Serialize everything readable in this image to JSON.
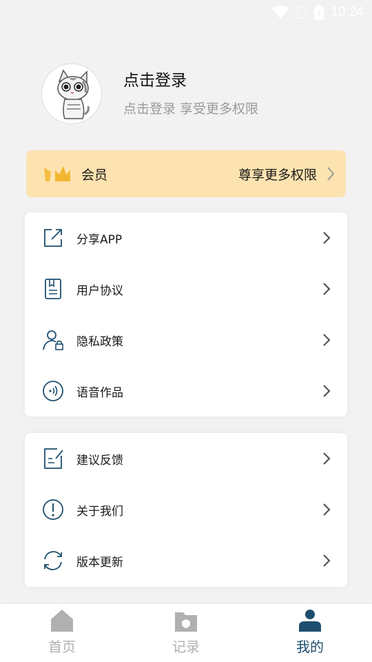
{
  "status_bar": {
    "time": "10:24"
  },
  "profile": {
    "title": "点击登录",
    "subtitle": "点击登录  享受更多权限"
  },
  "vip": {
    "label": "会员",
    "promo": "尊享更多权限"
  },
  "menu_group_1": [
    {
      "label": "分享APP",
      "icon": "share-icon"
    },
    {
      "label": "用户协议",
      "icon": "document-icon"
    },
    {
      "label": "隐私政策",
      "icon": "user-lock-icon"
    },
    {
      "label": "语音作品",
      "icon": "audio-wave-icon"
    }
  ],
  "menu_group_2": [
    {
      "label": "建议反馈",
      "icon": "feedback-edit-icon"
    },
    {
      "label": "关于我们",
      "icon": "info-exclamation-icon"
    },
    {
      "label": "版本更新",
      "icon": "refresh-icon"
    }
  ],
  "tabbar": {
    "items": [
      {
        "label": "首页",
        "icon": "home-icon"
      },
      {
        "label": "记录",
        "icon": "folder-icon"
      },
      {
        "label": "我的",
        "icon": "person-icon"
      }
    ],
    "active": "我的"
  },
  "colors": {
    "accent": "#1d4e6e",
    "vip_bg": "#fde3b0",
    "vip_icon": "#f2b630",
    "inactive": "#b0b0b0"
  }
}
